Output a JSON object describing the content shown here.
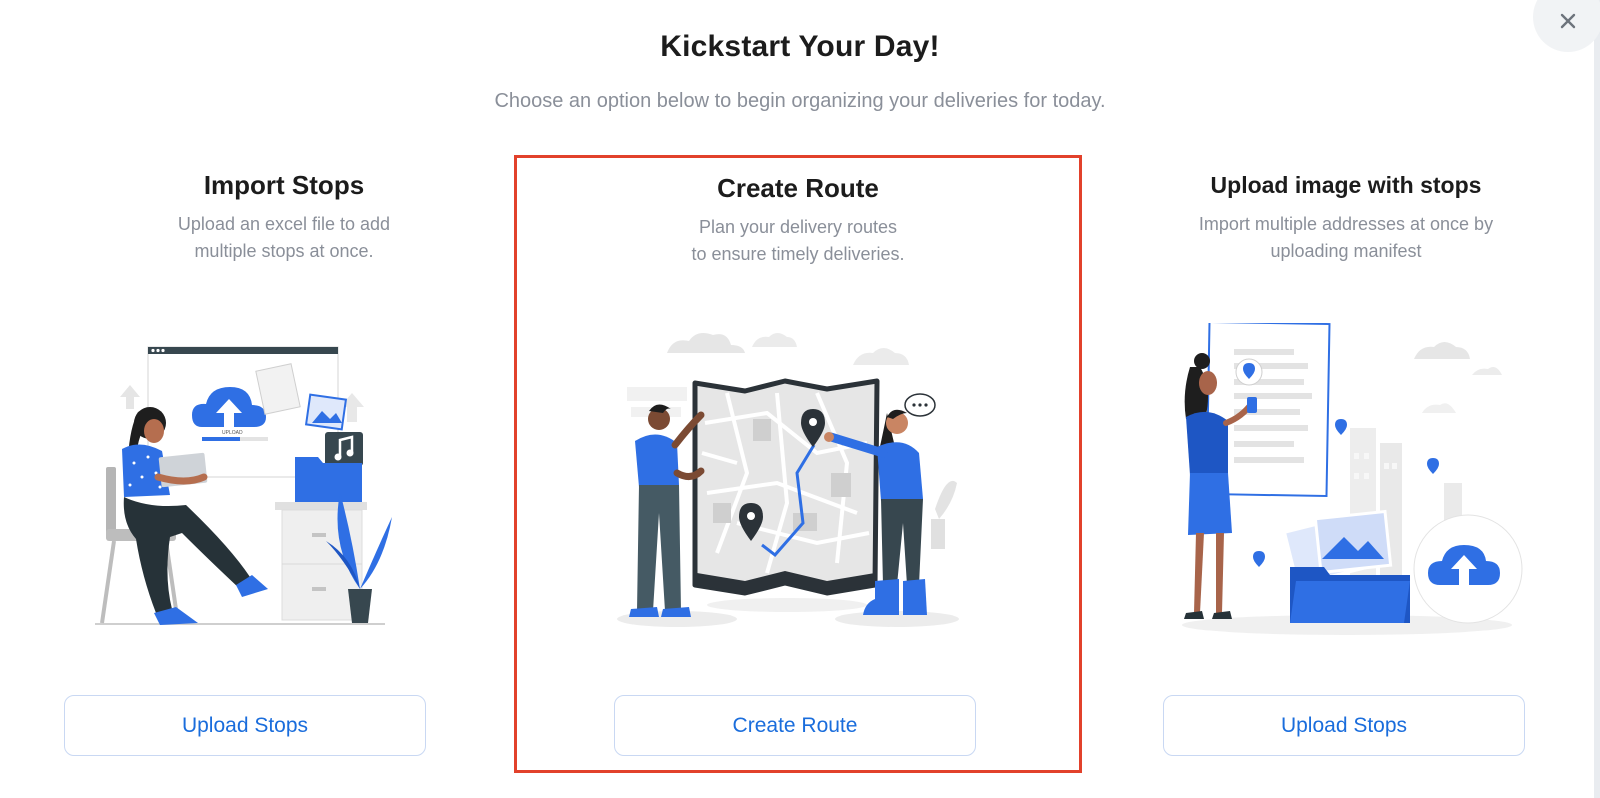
{
  "header": {
    "title": "Kickstart Your Day!",
    "subtitle": "Choose an option below to begin organizing your deliveries for today."
  },
  "close": {
    "icon": "close-icon"
  },
  "cards": [
    {
      "title": "Import Stops",
      "description_line1": "Upload an excel file to add",
      "description_line2": "multiple stops at once.",
      "button_label": "Upload Stops",
      "illustration": "person-uploading-files-illustration",
      "illustration_text": "UPLOAD"
    },
    {
      "title": "Create Route",
      "description_line1": "Plan your delivery routes",
      "description_line2": "to ensure timely deliveries.",
      "button_label": "Create Route",
      "illustration": "people-holding-map-illustration",
      "selected": true
    },
    {
      "title": "Upload image with stops",
      "description_line1": "Import multiple addresses at once by",
      "description_line2": "uploading manifest",
      "button_label": "Upload Stops",
      "illustration": "person-with-manifest-illustration"
    }
  ],
  "colors": {
    "accent": "#1a6ddc",
    "illustration_blue": "#2f6fe4",
    "selected_border": "#e2412b",
    "muted_text": "#8a8f99",
    "button_border": "#c9d8f3"
  }
}
